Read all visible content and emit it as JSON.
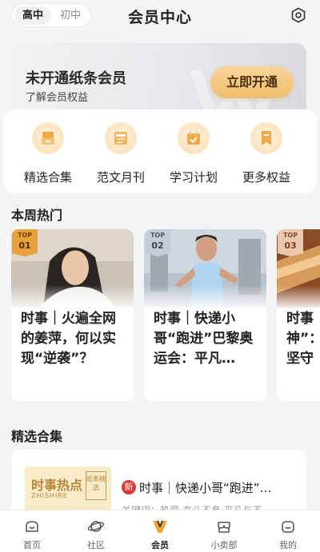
{
  "header": {
    "level_tabs": [
      {
        "label": "高中",
        "active": true
      },
      {
        "label": "初中",
        "active": false
      }
    ],
    "title": "会员中心",
    "settings_icon": "gear-icon"
  },
  "banner": {
    "title": "未开通纸条会员",
    "subtitle": "了解会员权益",
    "cta": "立即开通",
    "cta_color": "#efbe6c"
  },
  "benefits": [
    {
      "label": "精选合集",
      "icon": "collection-icon"
    },
    {
      "label": "范文月刊",
      "icon": "magazine-icon"
    },
    {
      "label": "学习计划",
      "icon": "plan-icon"
    },
    {
      "label": "更多权益",
      "icon": "bookmark-icon"
    }
  ],
  "hot": {
    "title": "本周热门",
    "cards": [
      {
        "rank_top": "TOP",
        "rank": "01",
        "text": "时事｜火遍全网的姜萍，何以实现“逆袭”？"
      },
      {
        "rank_top": "TOP",
        "rank": "02",
        "text": "时事｜快递小哥“跑进”巴黎奥运会：平凡…"
      },
      {
        "rank_top": "TOP",
        "rank": "03",
        "text": "时事神”：坚守"
      }
    ]
  },
  "collections": {
    "title": "精选合集",
    "item": {
      "thumb_title": "时事热点",
      "thumb_sub": "ZHISHIRE",
      "thumb_seal": "纸条精选",
      "badge": "新",
      "title": "时事｜快递小哥“跑进”…",
      "keywords": "关键词：热爱 奋斗不息 平凡与不"
    }
  },
  "tabbar": [
    {
      "label": "首页",
      "icon": "home-icon",
      "active": false
    },
    {
      "label": "社区",
      "icon": "planet-icon",
      "active": false
    },
    {
      "label": "会员",
      "icon": "vip-icon",
      "active": true
    },
    {
      "label": "小卖部",
      "icon": "shop-icon",
      "active": false
    },
    {
      "label": "我的",
      "icon": "profile-icon",
      "active": false
    }
  ]
}
